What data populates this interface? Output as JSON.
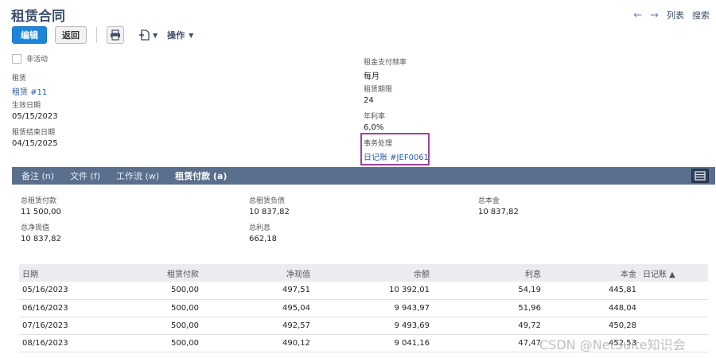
{
  "header": {
    "title": "租赁合同",
    "nav_list": "列表",
    "nav_search": "搜索"
  },
  "toolbar": {
    "edit_label": "编辑",
    "back_label": "返回",
    "actions_label": "操作"
  },
  "fields": {
    "inactive_label": "非活动",
    "lease_label": "租赁",
    "lease_value": "租赁 #11",
    "effective_label": "生效日期",
    "effective_value": "05/15/2023",
    "end_label": "租赁结束日期",
    "end_value": "04/15/2025",
    "freq_label": "租金支付频率",
    "freq_value": "每月",
    "term_label": "租赁期限",
    "term_value": "24",
    "rate_label": "年利率",
    "rate_value": "6,0%",
    "txn_label": "事务处理",
    "txn_value": "日记账 #JEF0061"
  },
  "tabs": {
    "notes": "备注 (n)",
    "files": "文件 (f)",
    "workflow": "工作流 (w)",
    "payments": "租赁付款 (a)"
  },
  "summary": {
    "total_payments_label": "总租赁付款",
    "total_payments_value": "11 500,00",
    "total_liability_label": "总租赁负债",
    "total_liability_value": "10 837,82",
    "total_principal_label": "总本金",
    "total_principal_value": "10 837,82",
    "total_pv_label": "总净现值",
    "total_pv_value": "10 837,82",
    "total_interest_label": "总利息",
    "total_interest_value": "662,18"
  },
  "table": {
    "headers": [
      "日期",
      "租赁付款",
      "净现值",
      "余额",
      "利息",
      "本金",
      "日记账 ▲"
    ],
    "rows": [
      [
        "05/16/2023",
        "500,00",
        "497,51",
        "10 392,01",
        "54,19",
        "445,81",
        ""
      ],
      [
        "06/16/2023",
        "500,00",
        "495,04",
        "9 943,97",
        "51,96",
        "448,04",
        ""
      ],
      [
        "07/16/2023",
        "500,00",
        "492,57",
        "9 493,69",
        "49,72",
        "450,28",
        ""
      ],
      [
        "08/16/2023",
        "500,00",
        "490,12",
        "9 041,16",
        "47,47",
        "452,53",
        ""
      ]
    ]
  },
  "watermark": "CSDN @NetSuite知识会",
  "colors": {
    "primary_button": "#1e85d9",
    "tab_bar": "#5a6f8d",
    "title": "#3d4f6b",
    "link": "#2a5da8",
    "highlight": "#a040a0"
  },
  "icons": [
    "back-arrow-icon",
    "forward-arrow-icon",
    "print-icon",
    "new-document-icon",
    "chevron-down-icon",
    "collapse-toggle-icon"
  ]
}
